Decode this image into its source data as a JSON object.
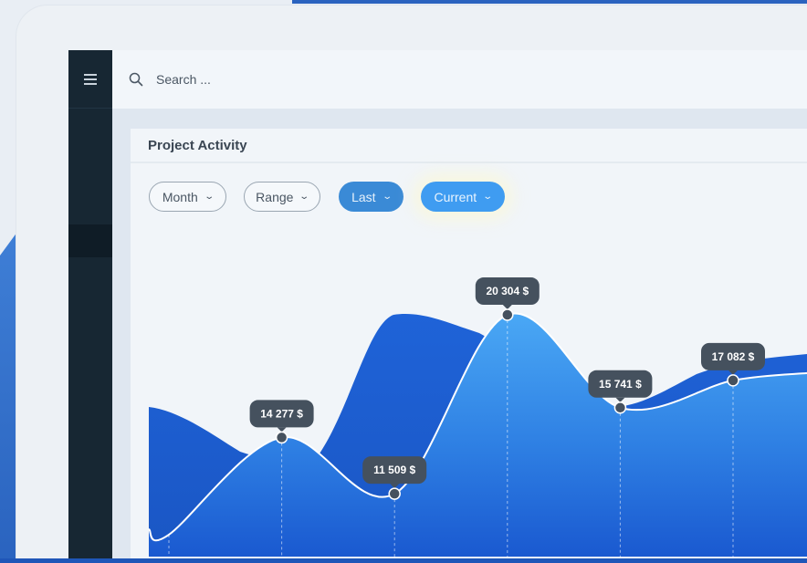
{
  "search": {
    "placeholder": "Search ..."
  },
  "card": {
    "title": "Project Activity"
  },
  "filters": [
    {
      "label": "Month"
    },
    {
      "label": "Range"
    },
    {
      "label": "Last"
    },
    {
      "label": "Current"
    }
  ],
  "colors": {
    "sidebar": "#172733",
    "accent": "#3f9cf1",
    "area_dark": "#1f63d8",
    "area_light": "#4aa8f5",
    "tooltip": "#45515e"
  },
  "icons": {
    "menu": "hamburger-menu-icon",
    "search": "search-icon",
    "chevron": "chevron-down-icon"
  },
  "chart_data": {
    "type": "area",
    "title": "",
    "xlabel": "",
    "ylabel": "",
    "x": [
      1,
      2,
      3,
      4,
      5,
      6
    ],
    "series": [
      {
        "values": [
          9500,
          14277,
          11509,
          20304,
          15741,
          17082
        ]
      }
    ],
    "annotations": [
      "14 277 $",
      "11 509 $",
      "20 304 $",
      "15 741 $",
      "17 082 $"
    ],
    "grid": true,
    "legend": "none"
  }
}
